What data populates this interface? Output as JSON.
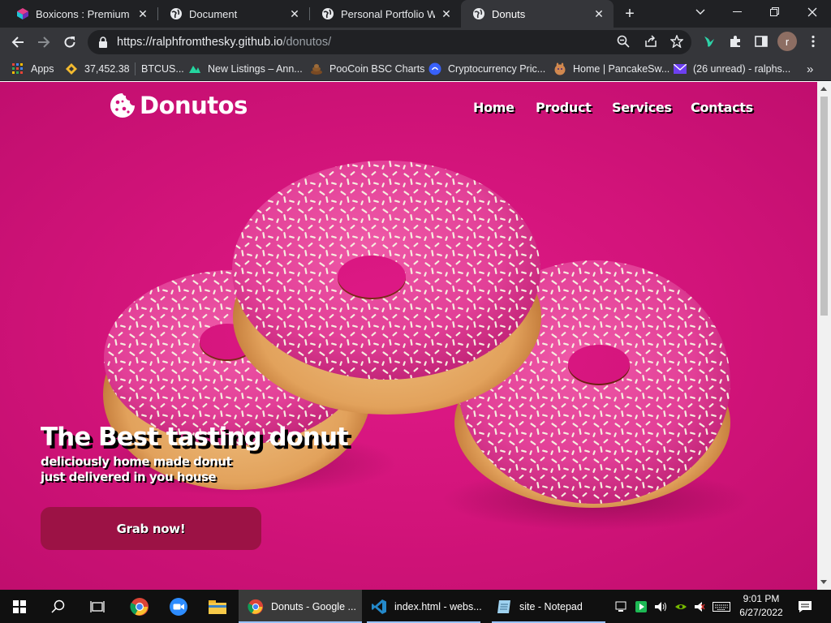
{
  "browser": {
    "tabs": [
      {
        "title": "Boxicons : Premium we",
        "active": false
      },
      {
        "title": "Document",
        "active": false
      },
      {
        "title": "Personal Portfolio Web",
        "active": false
      },
      {
        "title": "Donuts",
        "active": true
      }
    ],
    "url_host": "https://ralphfromthesky.github.io",
    "url_path": "/donutos/",
    "profile_initial": "r",
    "bookmarks": [
      {
        "label": "Apps",
        "icon": "apps-grid-icon"
      },
      {
        "label": "37,452.38",
        "icon": "binance-icon"
      },
      {
        "label": "BTCUS...",
        "icon": "folder-icon"
      },
      {
        "label": "New Listings – Ann...",
        "icon": "coinmarket-icon"
      },
      {
        "label": "PooCoin BSC Charts",
        "icon": "poocoin-icon"
      },
      {
        "label": "Cryptocurrency Pric...",
        "icon": "coingecko-icon"
      },
      {
        "label": "Home | PancakeSw...",
        "icon": "pancake-icon"
      },
      {
        "label": "(26 unread) - ralphs...",
        "icon": "mail-icon"
      }
    ],
    "bookmarks_overflow": "»"
  },
  "page": {
    "brand": "Donutos",
    "nav": [
      "Home",
      "Product",
      "Services",
      "Contacts"
    ],
    "hero_title": "The Best tasting donut",
    "hero_sub1": "deliciously home made donut",
    "hero_sub2": "just delivered in you house",
    "cta_label": "Grab now!",
    "colors": {
      "background": "#d2137d",
      "cta": "#9c1245",
      "frosting": "#e23f97",
      "dough": "#e2a25c"
    }
  },
  "taskbar": {
    "apps": [
      {
        "label": "Donuts - Google ...",
        "icon": "chrome-icon",
        "active": true
      },
      {
        "label": "index.html - webs...",
        "icon": "vscode-icon",
        "active": false
      },
      {
        "label": "site - Notepad",
        "icon": "notepad-icon",
        "active": false
      }
    ],
    "time": "9:01 PM",
    "date": "6/27/2022"
  }
}
